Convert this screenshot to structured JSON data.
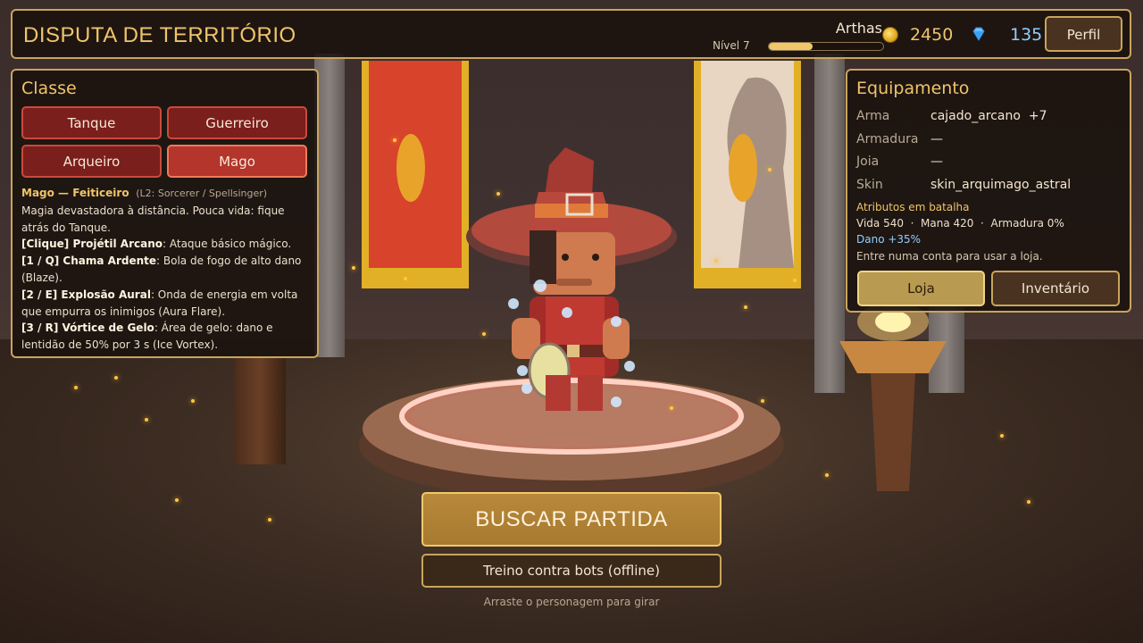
{
  "header": {
    "title": "DISPUTA DE TERRITÓRIO",
    "player_name": "Arthas",
    "level_label": "Nível 7",
    "level_progress": 0.38,
    "gold": "2450",
    "gems": "135",
    "profile_label": "Perfil"
  },
  "class_panel": {
    "title": "Classe",
    "classes": [
      {
        "label": "Tanque",
        "active": false
      },
      {
        "label": "Guerreiro",
        "active": false
      },
      {
        "label": "Arqueiro",
        "active": false
      },
      {
        "label": "Mago",
        "active": true
      }
    ],
    "selected_name": "Mago — Feiticeiro",
    "selected_alt": "(L2: Sorcerer / Spellsinger)",
    "selected_desc": "Magia devastadora à distância. Pouca vida: fique atrás do Tanque.",
    "skills": [
      {
        "key": "[Clique] Projétil Arcano",
        "desc": ": Ataque básico mágico."
      },
      {
        "key": "[1 / Q] Chama Ardente",
        "desc": ": Bola de fogo de alto dano (Blaze)."
      },
      {
        "key": "[2 / E] Explosão Aural",
        "desc": ": Onda de energia em volta que empurra os inimigos (Aura Flare)."
      },
      {
        "key": "[3 / R] Vórtice de Gelo",
        "desc": ": Área de gelo: dano e lentidão de 50% por 3 s (Ice Vortex)."
      }
    ]
  },
  "equipment": {
    "title": "Equipamento",
    "rows": [
      {
        "label": "Arma",
        "value": "cajado_arcano  +7"
      },
      {
        "label": "Armadura",
        "value": "—"
      },
      {
        "label": "Joia",
        "value": "—"
      },
      {
        "label": "Skin",
        "value": "skin_arquimago_astral"
      }
    ],
    "attr_title": "Atributos em batalha",
    "attr_line": "Vida 540  ·  Mana 420  ·  Armadura 0%",
    "damage_line": "Dano +35%",
    "shop_note": "Entre numa conta para usar a loja.",
    "shop_label": "Loja",
    "inventory_label": "Inventário"
  },
  "actions": {
    "find_match": "BUSCAR PARTIDA",
    "training": "Treino contra bots (offline)",
    "hint": "Arraste o personagem para girar"
  },
  "colors": {
    "accent": "#f0c46a",
    "panel_border": "#c9a45c",
    "class_active": "#b3352c",
    "class_inactive": "#7a1f1c",
    "gem": "#8fd0ff"
  }
}
